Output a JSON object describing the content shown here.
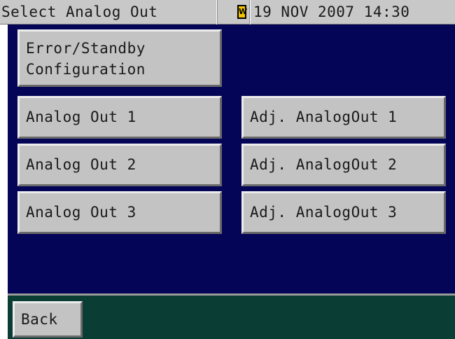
{
  "titlebar": {
    "title": "Select Analog Out",
    "warning_icon_letter": "W",
    "datetime": "19 NOV 2007 14:30"
  },
  "colors": {
    "main_background": "#050558",
    "footer_background": "#0a3d33",
    "button_face": "#c3c3c3",
    "titlebar_background": "#c8c8c8",
    "warning_icon": "#f2c400"
  },
  "buttons": {
    "error_standby": [
      "Error/Standby",
      "Configuration"
    ],
    "analog_out_1": "Analog Out 1",
    "analog_out_2": "Analog Out 2",
    "analog_out_3": "Analog Out 3",
    "adj_analog_out_1": "Adj. AnalogOut 1",
    "adj_analog_out_2": "Adj. AnalogOut 2",
    "adj_analog_out_3": "Adj. AnalogOut 3"
  },
  "footer": {
    "back_label": "Back"
  }
}
